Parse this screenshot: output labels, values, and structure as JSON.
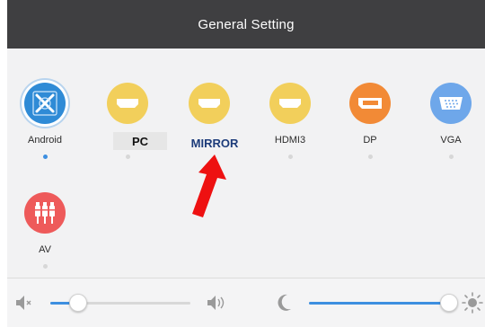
{
  "header": {
    "title": "General Setting"
  },
  "sources": [
    {
      "label": "Android",
      "icon": "android-source-icon",
      "color": "#2f8bd6",
      "active": true
    },
    {
      "label": "PC",
      "icon": "hdmi-port-icon",
      "color": "#f2cf5b",
      "active": false
    },
    {
      "label": "MIRROR",
      "icon": "hdmi-port-icon",
      "color": "#f2cf5b",
      "active": false
    },
    {
      "label": "HDMI3",
      "icon": "hdmi-port-icon",
      "color": "#f2cf5b",
      "active": false
    },
    {
      "label": "DP",
      "icon": "displayport-icon",
      "color": "#f28a36",
      "active": false
    },
    {
      "label": "VGA",
      "icon": "vga-port-icon",
      "color": "#6ea7ea",
      "active": false
    },
    {
      "label": "AV",
      "icon": "av-rca-icon",
      "color": "#ee5a5a",
      "active": false
    }
  ],
  "annotation": {
    "arrow_color": "#ee1111"
  },
  "volume": {
    "icon_left": "speaker-mute-icon",
    "icon_right": "speaker-loud-icon",
    "level": 0.2
  },
  "brightness": {
    "icon_left": "moon-icon",
    "icon_right": "sun-icon",
    "level": 1.0
  },
  "colors": {
    "accent": "#3d8fe0",
    "header_bg": "#3f3f41"
  }
}
